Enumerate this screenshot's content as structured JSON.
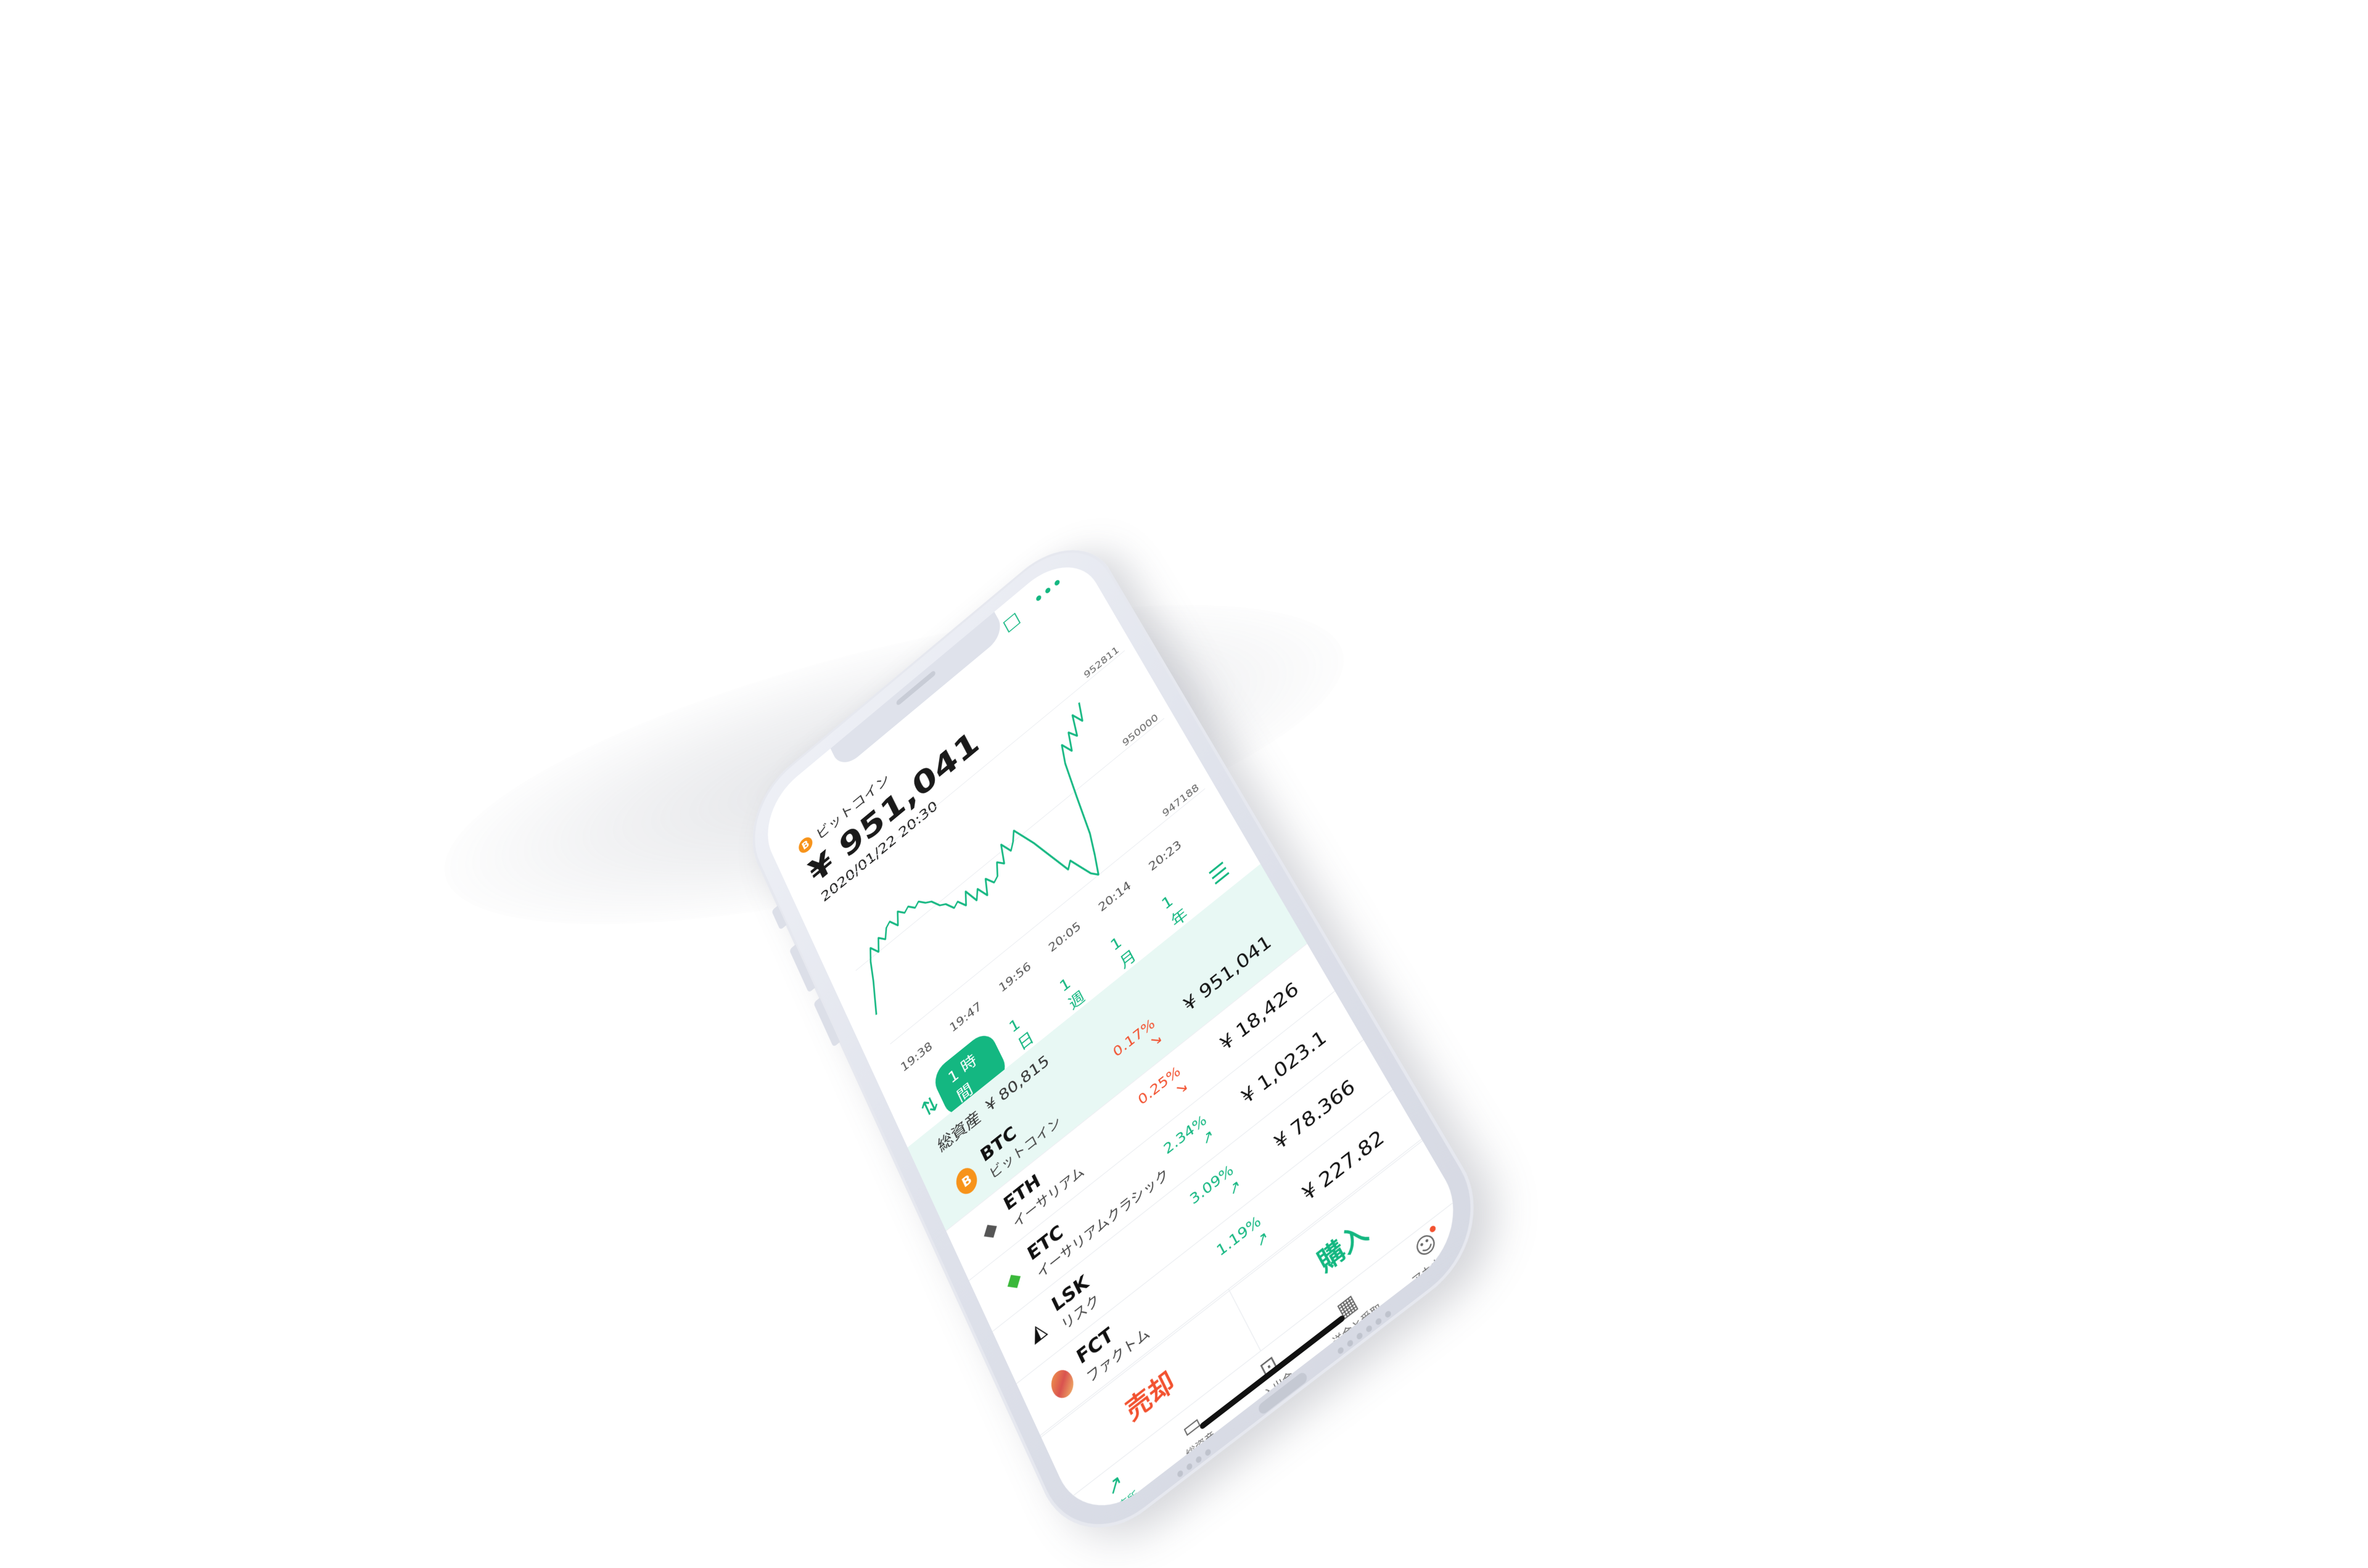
{
  "header": {
    "coin_icon": "bitcoin-icon",
    "coin_icon_glyph": "B",
    "coin_name": "ビットコイン",
    "price": "¥ 951,041",
    "datetime": "2020/01/22 20:30",
    "chat_icon": "chat-bubble-icon",
    "more_icon": "more-dots-icon"
  },
  "chart_data": {
    "type": "line",
    "title": "",
    "xlabel": "",
    "ylabel": "",
    "ylim": [
      947188,
      952811
    ],
    "y_ticks": [
      "952811",
      "950000",
      "947188"
    ],
    "x_ticks": [
      "19:38",
      "19:47",
      "19:56",
      "20:05",
      "20:14",
      "20:23"
    ],
    "series": [
      {
        "color": "#14b781",
        "values": [
          948300,
          948800,
          949300,
          949900,
          950300,
          950000,
          950400,
          950200,
          950500,
          950600,
          950300,
          950700,
          950500,
          950600,
          950400,
          950500,
          950300,
          950200,
          949900,
          949800,
          949500,
          949600,
          949300,
          949700,
          949200,
          949500,
          949100,
          949600,
          949300,
          949400,
          949800,
          949600,
          950200,
          949800,
          950000,
          950300,
          949900,
          949500,
          949000,
          948500,
          948000,
          948200,
          947800,
          947400,
          947200,
          947800,
          948500,
          949800,
          951000,
          951600,
          951200,
          951800,
          951500,
          952200,
          951800,
          952400
        ]
      }
    ]
  },
  "period_selector": {
    "chart_type_icon": "candlestick-icon",
    "list_icon": "list-icon",
    "options": [
      "1 時間",
      "1 日",
      "1 週",
      "1 月",
      "1 年"
    ],
    "active_index": 0
  },
  "total_assets": {
    "label": "総資産",
    "value": "¥ 80,815"
  },
  "coins": [
    {
      "icon": "bitcoin-icon",
      "glyph": "B",
      "symbol": "BTC",
      "name": "ビットコイン",
      "change": "0.17%",
      "change_arrow": "↘",
      "direction": "down",
      "price": "¥ 951,041",
      "highlighted": true
    },
    {
      "icon": "ethereum-icon",
      "glyph": "◆",
      "symbol": "ETH",
      "name": "イーサリアム",
      "change": "0.25%",
      "change_arrow": "↘",
      "direction": "down",
      "price": "¥ 18,426",
      "highlighted": false
    },
    {
      "icon": "ethereum-classic-icon",
      "glyph": "◆",
      "symbol": "ETC",
      "name": "イーサリアムクラシック",
      "change": "2.34%",
      "change_arrow": "↗",
      "direction": "up",
      "price": "¥ 1,023.1",
      "highlighted": false
    },
    {
      "icon": "lisk-icon",
      "glyph": "◭",
      "symbol": "LSK",
      "name": "リスク",
      "change": "3.09%",
      "change_arrow": "↗",
      "direction": "up",
      "price": "¥ 78.366",
      "highlighted": false
    },
    {
      "icon": "factom-icon",
      "glyph": "",
      "symbol": "FCT",
      "name": "ファクトム",
      "change": "1.19%",
      "change_arrow": "↗",
      "direction": "up",
      "price": "¥ 227.82",
      "highlighted": false
    }
  ],
  "trade": {
    "sell_label": "売却",
    "buy_label": "購入"
  },
  "tabs": [
    {
      "icon": "trending-up-icon",
      "glyph": "↗",
      "label": "販売所",
      "active": true
    },
    {
      "icon": "wallet-icon",
      "glyph": "▭",
      "label": "総資産",
      "active": false
    },
    {
      "icon": "deposit-icon",
      "glyph": "⊡",
      "label": "入出金",
      "active": false
    },
    {
      "icon": "qr-code-icon",
      "glyph": "▦",
      "label": "送金と受取",
      "active": false
    },
    {
      "icon": "account-icon",
      "glyph": "☺",
      "label": "アカウント",
      "active": false,
      "notification": true
    }
  ],
  "colors": {
    "accent": "#14b781",
    "down": "#f2512f",
    "highlight_row": "#e8f8f4",
    "bitcoin": "#f7931a"
  }
}
